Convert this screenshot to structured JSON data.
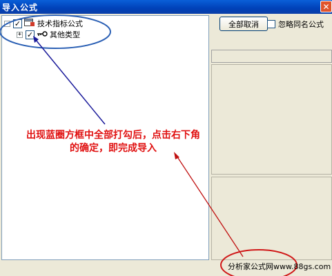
{
  "window": {
    "title": "导入公式",
    "close_icon": "close-icon"
  },
  "tree": {
    "items": [
      {
        "expander": "-",
        "checked": true,
        "icon": "folder-icon",
        "label": "技术指标公式"
      },
      {
        "expander": "+",
        "checked": true,
        "icon": "key-icon",
        "label": "其他类型"
      }
    ]
  },
  "right_panel": {
    "deselect_all_label": "全部取消",
    "ignore_same_name_label": "忽略同名公式",
    "ignore_same_name_checked": false
  },
  "annotation": {
    "text": "出现蓝圈方框中全部打勾后，点击右下角的确定，即完成导入"
  },
  "watermark": {
    "text": "分析家公式网www.88gs.com"
  },
  "colors": {
    "title_bar": "#0a5fd8",
    "annotation": "#e01010",
    "highlight_blue": "#2a5fb4",
    "highlight_red": "#d01818"
  }
}
